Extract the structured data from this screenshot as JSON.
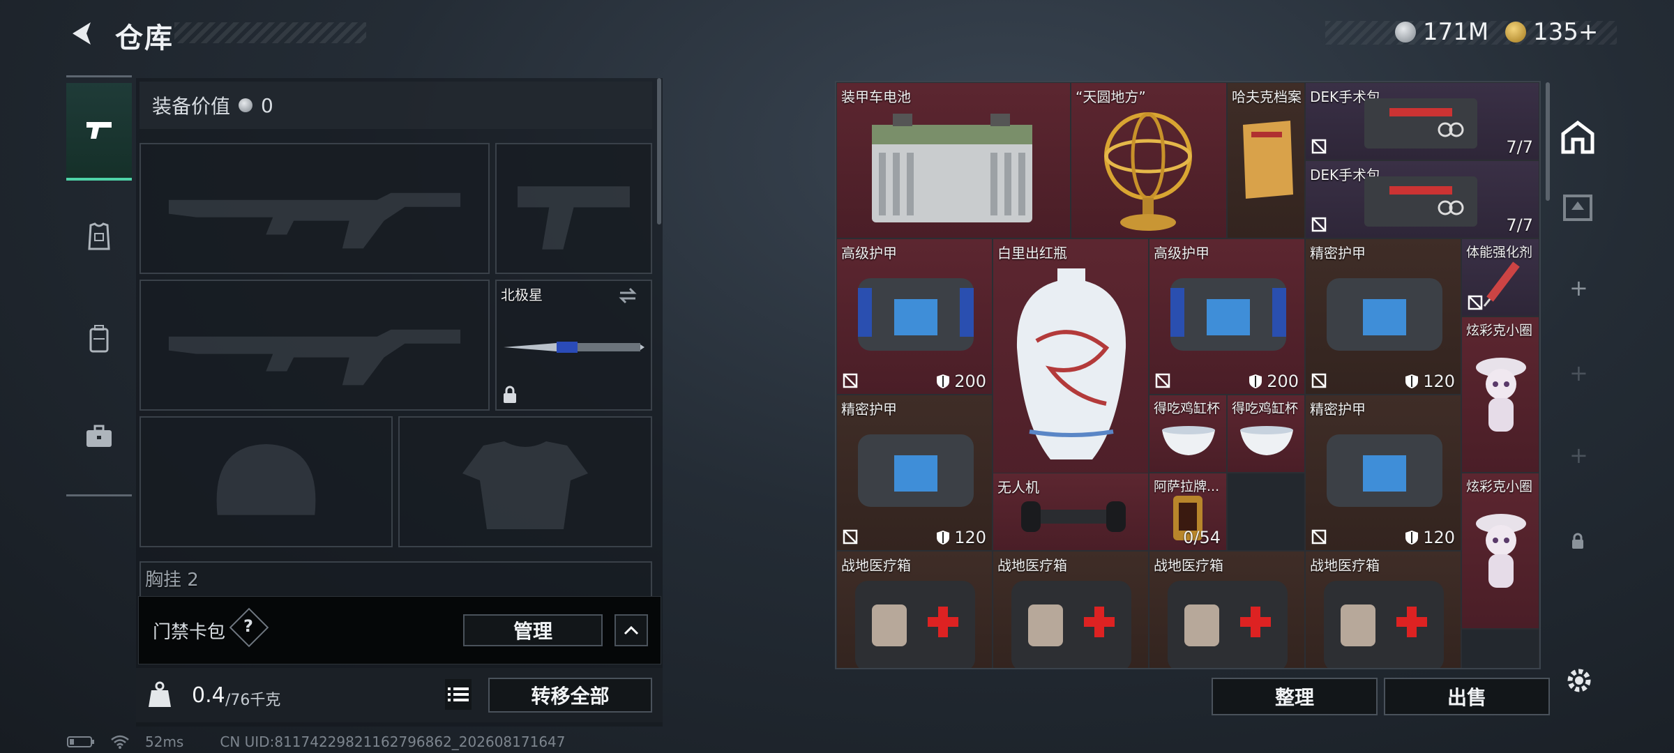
{
  "header": {
    "title": "仓库"
  },
  "currency": [
    {
      "icon": "silver-coin-icon",
      "value": "171M"
    },
    {
      "icon": "gold-triangle-coin-icon",
      "value": "135+"
    }
  ],
  "loadout": {
    "equip_value_label": "装备价值",
    "equip_value": "0",
    "melee_slot_name": "北极星",
    "chest_rig_label": "胸挂",
    "chest_rig_value": "2"
  },
  "keycard": {
    "label": "门禁卡包",
    "help": "?",
    "manage_label": "管理"
  },
  "weight": {
    "current": "0.4",
    "max": "/76千克"
  },
  "transfer_all_label": "转移全部",
  "bottom_actions": {
    "sort_label": "整理",
    "sell_label": "出售"
  },
  "status": {
    "ping": "52ms",
    "uid": "CN UID:81174229821162796862_202608171647"
  },
  "items": {
    "battery": {
      "name": "装甲车电池"
    },
    "armillary": {
      "name": "“天圆地方”"
    },
    "hafuke": {
      "name": "哈夫克档案"
    },
    "dek1": {
      "name": "DEK手术包",
      "count": "7/7"
    },
    "dek2": {
      "name": "DEK手术包",
      "count": "7/7"
    },
    "adv_armor1": {
      "name": "高级护甲",
      "dur": "200"
    },
    "vase": {
      "name": "白里出红瓶"
    },
    "adv_armor2": {
      "name": "高级护甲",
      "dur": "200"
    },
    "prec_armor1": {
      "name": "精密护甲",
      "dur": "120"
    },
    "stim": {
      "name": "体能强化剂"
    },
    "doll1": {
      "name": "炫彩克小圈"
    },
    "prec_armor2": {
      "name": "精密护甲",
      "dur": "120"
    },
    "cup1": {
      "name": "得吃鸡缸杯"
    },
    "cup2": {
      "name": "得吃鸡缸杯"
    },
    "prec_armor3": {
      "name": "精密护甲",
      "dur": "120"
    },
    "drone": {
      "name": "无人机"
    },
    "asala": {
      "name": "阿萨拉牌...",
      "count": "0/54"
    },
    "doll2": {
      "name": "炫彩克小圈"
    },
    "medkit1": {
      "name": "战地医疗箱"
    },
    "medkit2": {
      "name": "战地医疗箱"
    },
    "medkit3": {
      "name": "战地医疗箱"
    },
    "medkit4": {
      "name": "战地医疗箱"
    }
  },
  "colors": {
    "accent": "#4fd3a8",
    "rarity_red": "#5c2630",
    "rarity_brown": "#3f2d27",
    "rarity_purple": "#3a3046"
  }
}
